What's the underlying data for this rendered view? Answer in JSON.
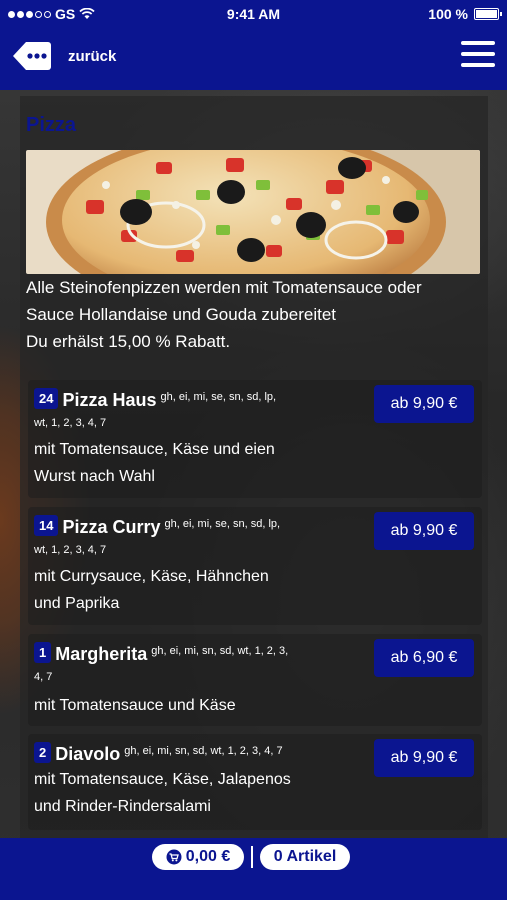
{
  "status_bar": {
    "carrier": "GS",
    "time": "9:41 AM",
    "battery": "100 %"
  },
  "nav": {
    "back_label": "zurück"
  },
  "section": {
    "title": "Pizza",
    "intro_line1": "Alle Steinofenpizzen werden mit Tomatensauce oder",
    "intro_line2": "Sauce Hollandaise und Gouda zubereitet",
    "intro_line3": "Du erhälst 15,00 % Rabatt."
  },
  "items": [
    {
      "number": "24",
      "name": "Pizza Haus",
      "allergens": "gh, ei, mi, se, sn, sd, lp,",
      "allergens_cont": "wt, 1, 2, 3, 4, 7",
      "desc_line1": "mit Tomatensauce, Käse und eien",
      "desc_line2": "Wurst nach Wahl",
      "price": "ab 9,90 €"
    },
    {
      "number": "14",
      "name": "Pizza Curry",
      "allergens": "gh, ei, mi, se, sn, sd, lp,",
      "allergens_cont": "wt, 1, 2, 3, 4, 7",
      "desc_line1": "mit Currysauce, Käse, Hähnchen",
      "desc_line2": "und Paprika",
      "price": "ab 9,90 €"
    },
    {
      "number": "1",
      "name": "Margherita",
      "allergens": "gh, ei, mi, sn, sd, wt, 1, 2, 3,",
      "allergens_cont": "4, 7",
      "desc_line1": "mit Tomatensauce und Käse",
      "price": "ab 6,90 €"
    },
    {
      "number": "2",
      "name": "Diavolo",
      "allergens": "gh, ei, mi, sn, sd, wt, 1, 2, 3, 4, 7",
      "desc_line1": "mit Tomatensauce, Käse, Jalapenos",
      "desc_line2": "und Rinder-Rindersalami",
      "price": "ab 9,90 €"
    }
  ],
  "cart": {
    "total": "0,00 €",
    "articles": "0 Artikel"
  },
  "colors": {
    "brand_blue": "#0b1590"
  }
}
